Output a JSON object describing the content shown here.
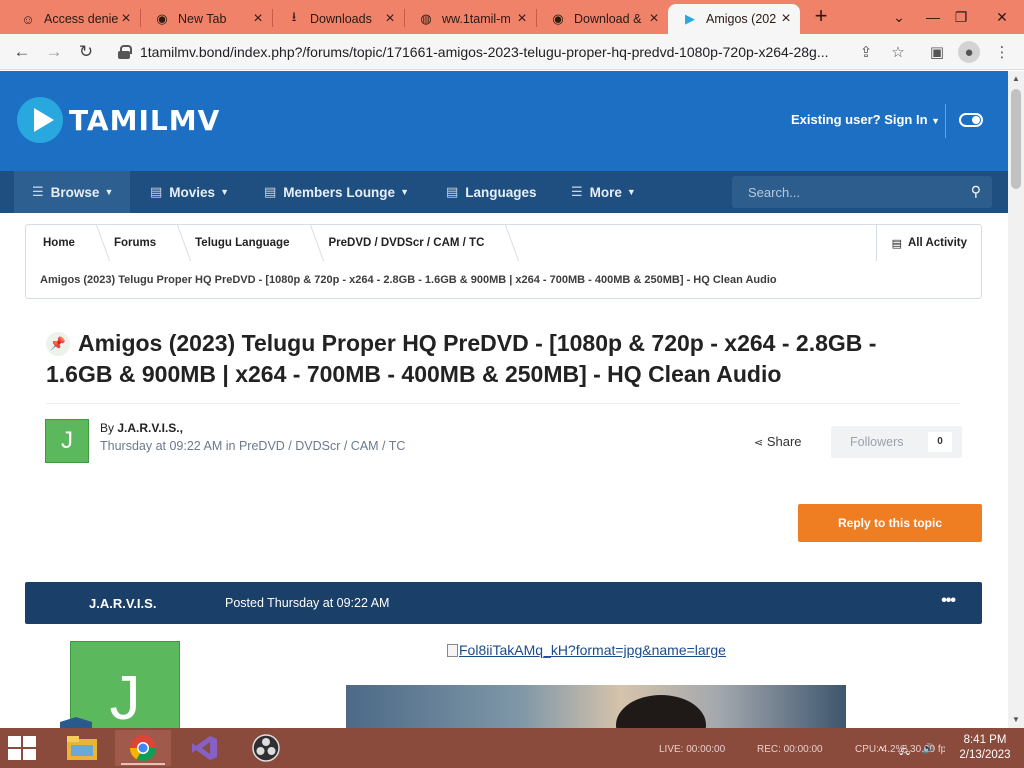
{
  "browser": {
    "tabs": [
      {
        "label": "Access denie",
        "icon": "cloudflare-icon"
      },
      {
        "label": "New Tab",
        "icon": "chrome-icon"
      },
      {
        "label": "Downloads",
        "icon": "download-icon"
      },
      {
        "label": "ww.1tamil-m",
        "icon": "globe-icon"
      },
      {
        "label": "Download &",
        "icon": "chrome-icon"
      },
      {
        "label": "Amigos (202",
        "icon": "tamilmv-icon",
        "active": true
      }
    ],
    "url": "1tamilmv.bond/index.php?/forums/topic/171661-amigos-2023-telugu-proper-hq-predvd-1080p-720p-x264-28g..."
  },
  "site": {
    "logo_text": "TAMILMV",
    "signin_label": "Existing user? Sign In",
    "nav": {
      "items": [
        {
          "label": "Browse"
        },
        {
          "label": "Movies"
        },
        {
          "label": "Members Lounge"
        },
        {
          "label": "Languages"
        },
        {
          "label": "More"
        }
      ],
      "search_placeholder": "Search..."
    },
    "breadcrumb": {
      "items": [
        "Home",
        "Forums",
        "Telugu Language",
        "PreDVD / DVDScr / CAM / TC"
      ],
      "all_activity": "All Activity",
      "current": "Amigos (2023) Telugu Proper HQ PreDVD - [1080p & 720p - x264 - 2.8GB - 1.6GB & 900MB | x264 - 700MB - 400MB & 250MB] - HQ Clean Audio"
    }
  },
  "topic": {
    "title": "Amigos (2023) Telugu Proper HQ PreDVD - [1080p & 720p - x264 - 2.8GB - 1.6GB & 900MB | x264 - 700MB - 400MB & 250MB] - HQ Clean Audio",
    "author_initial": "J",
    "by_prefix": "By",
    "author": "J.A.R.V.I.S.,",
    "meta": "Thursday at 09:22 AM in PreDVD / DVDScr / CAM / TC",
    "share_label": "Share",
    "followers_label": "Followers",
    "followers_count": "0",
    "reply_label": "Reply to this topic"
  },
  "post": {
    "author": "J.A.R.V.I.S.",
    "posted": "Posted Thursday at 09:22 AM",
    "menu": "•••",
    "image_alt": "Fol8iiTakAMq_kH?format=jpg&name=large"
  },
  "taskbar": {
    "live": "LIVE: 00:00:00",
    "rec": "REC: 00:00:00",
    "cpu": "CPU: 4.2%, 30.00 fps",
    "time": "8:41 PM",
    "date": "2/13/2023"
  }
}
